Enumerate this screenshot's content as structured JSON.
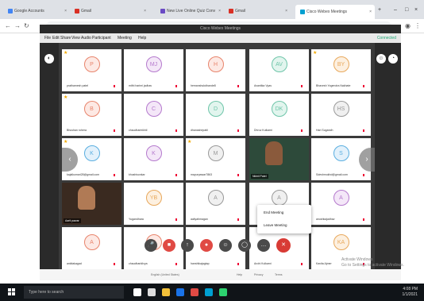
{
  "browser": {
    "tabs": [
      {
        "label": "Google Accounts",
        "color": "#4285f4"
      },
      {
        "label": "Gmail",
        "color": "#d93025"
      },
      {
        "label": "New Live Online Quiz Conv",
        "color": "#6a4bc4"
      },
      {
        "label": "Gmail",
        "color": "#d93025"
      },
      {
        "label": "Cisco Webex Meetings",
        "color": "#00a0d1"
      }
    ],
    "new_tab": "+",
    "window_controls": [
      "–",
      "□",
      "×"
    ]
  },
  "webex": {
    "window_title": "Cisco Webex Meetings",
    "menu": [
      "File",
      "Edit",
      "Share",
      "View",
      "Audio",
      "Participant",
      "Meeting",
      "Help"
    ],
    "connected": "Connected",
    "footer": {
      "language": "English (United States)",
      "links": [
        "Help",
        "Privacy",
        "Terms"
      ]
    },
    "watermark": [
      "Activate Windows",
      "Go to Settings to activate Windows."
    ]
  },
  "participants": [
    {
      "initials": "P",
      "name": "prathamesh patel",
      "color": "#e8846c",
      "bg": "#fde9e4",
      "star": true
    },
    {
      "initials": "MJ",
      "name": "mithi harimi jadhav",
      "color": "#b57acd",
      "bg": "#f4e7f8",
      "star": false
    },
    {
      "initials": "H",
      "name": "hemanshukdhande8",
      "color": "#e8846c",
      "bg": "#fde9e4",
      "star": false
    },
    {
      "initials": "AV",
      "name": "Avantika Vyas",
      "color": "#6ec5a9",
      "bg": "#e2f5ee",
      "star": false
    },
    {
      "initials": "BY",
      "name": "Bhavesh Yogendra Nakhate",
      "color": "#e8a85c",
      "bg": "#fdf0e0",
      "star": true
    },
    {
      "initials": "B",
      "name": "Bhushan rohera",
      "color": "#e8846c",
      "bg": "#fde9e4",
      "star": true
    },
    {
      "initials": "C",
      "name": "chaudharinikhil",
      "color": "#b57acd",
      "bg": "#f4e7f8",
      "star": false
    },
    {
      "initials": "D",
      "name": "dhanashripatil",
      "color": "#6ec5a9",
      "bg": "#e2f5ee",
      "star": false
    },
    {
      "initials": "DK",
      "name": "Dhruv Kulkarni",
      "color": "#6ec5a9",
      "bg": "#e2f5ee",
      "star": false
    },
    {
      "initials": "HS",
      "name": "Hari Sugandh",
      "color": "#999999",
      "bg": "#f0f0f0",
      "star": false
    },
    {
      "initials": "K",
      "name": "kajalkumari28@gmail.com",
      "color": "#5aaee0",
      "bg": "#e3f1fb",
      "star": true
    },
    {
      "initials": "K",
      "name": "khushisonkar",
      "color": "#b57acd",
      "bg": "#f4e7f8",
      "star": false
    },
    {
      "initials": "M",
      "name": "mayurpawar7863",
      "color": "#999999",
      "bg": "#f0f0f0",
      "star": true
    },
    {
      "video": true,
      "name": "Nikhil Patel",
      "skin": "#8a5a3c",
      "bgc": "#2d4a3a"
    },
    {
      "initials": "S",
      "name": "Sdeshmukhd@gmail.com",
      "color": "#5aaee0",
      "bg": "#e3f1fb",
      "star": false
    },
    {
      "video": true,
      "name": "Aarti pawar",
      "skin": "#b07a55",
      "bgc": "#3a2a20"
    },
    {
      "initials": "YB",
      "name": "Yugandhara",
      "color": "#e8a85c",
      "bg": "#fdf0e0",
      "star": false
    },
    {
      "initials": "A",
      "name": "aaliyahmagan",
      "color": "#999999",
      "bg": "#f0f0f0",
      "star": false
    },
    {
      "initials": "A",
      "name": "",
      "color": "#999999",
      "bg": "#f0f0f0",
      "star": false
    },
    {
      "initials": "A",
      "name": "anushkajadhav",
      "color": "#b57acd",
      "bg": "#f4e7f8",
      "star": false
    },
    {
      "initials": "A",
      "name": "ankitakagad",
      "color": "#e8846c",
      "bg": "#fde9e4",
      "star": false
    },
    {
      "initials": "R",
      "name": "chaudharidivya",
      "color": "#e8846c",
      "bg": "#fde9e4",
      "star": false
    },
    {
      "initials": "",
      "name": "hanshikajagtap",
      "color": "#999999",
      "bg": "#f0f0f0",
      "star": false
    },
    {
      "initials": "",
      "name": "Arohi Kulkarni",
      "color": "#999999",
      "bg": "#f0f0f0",
      "star": false
    },
    {
      "initials": "KA",
      "name": "Kavita Ajmer",
      "color": "#e8a85c",
      "bg": "#fdf0e0",
      "star": false
    }
  ],
  "context_menu": {
    "items": [
      "End Meeting",
      "Leave Meeting"
    ]
  },
  "controls": [
    {
      "glyph": "🎤",
      "name": "mute",
      "style": ""
    },
    {
      "glyph": "■",
      "name": "video",
      "style": "red"
    },
    {
      "glyph": "↑",
      "name": "share",
      "style": ""
    },
    {
      "glyph": "●",
      "name": "record",
      "style": "red"
    },
    {
      "glyph": "☺",
      "name": "participants",
      "style": ""
    },
    {
      "glyph": "◯",
      "name": "chat",
      "style": ""
    },
    {
      "glyph": "…",
      "name": "more",
      "style": ""
    },
    {
      "glyph": "✕",
      "name": "leave",
      "style": "leave"
    }
  ],
  "taskbar": {
    "search_placeholder": "Type here to search",
    "apps": [
      {
        "name": "cortana",
        "color": "#ffffff"
      },
      {
        "name": "task-view",
        "color": "#dddddd"
      },
      {
        "name": "file-explorer",
        "color": "#f3c13a"
      },
      {
        "name": "edge",
        "color": "#1a73e8"
      },
      {
        "name": "chrome",
        "color": "#e04a44"
      },
      {
        "name": "webex",
        "color": "#00a0d1"
      },
      {
        "name": "app",
        "color": "#2dd36f"
      }
    ],
    "time": "4:08 PM",
    "date": "1/1/2021"
  }
}
